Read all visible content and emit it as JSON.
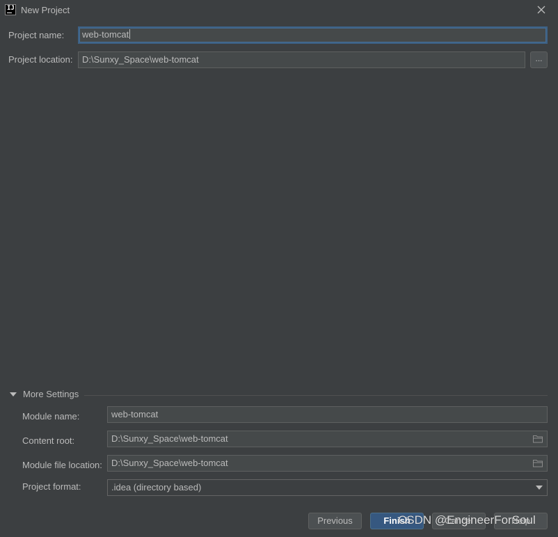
{
  "window": {
    "title": "New Project",
    "app_icon": "intellij-idea-icon",
    "app_icon_text": "IJ"
  },
  "project": {
    "name_label": "Project name:",
    "name_value": "web-tomcat",
    "location_label": "Project location:",
    "location_value": "D:\\Sunxy_Space\\web-tomcat",
    "browse_label": "..."
  },
  "more_settings": {
    "header_label": "More Settings",
    "expanded": true,
    "module_name_label": "Module name:",
    "module_name_value": "web-tomcat",
    "content_root_label": "Content root:",
    "content_root_value": "D:\\Sunxy_Space\\web-tomcat",
    "module_file_label": "Module file location:",
    "module_file_value": "D:\\Sunxy_Space\\web-tomcat",
    "project_format_label": "Project format:",
    "project_format_value": ".idea (directory based)"
  },
  "buttons": {
    "previous": "Previous",
    "finish": "Finish",
    "cancel": "Cancel",
    "help": "Help"
  },
  "watermark": "CSDN @EngineerForSoul",
  "colors": {
    "background": "#3c3f41",
    "field_bg": "#45494a",
    "focus_border": "#3d6185",
    "primary_button": "#365880",
    "text": "#bbbbbb"
  }
}
